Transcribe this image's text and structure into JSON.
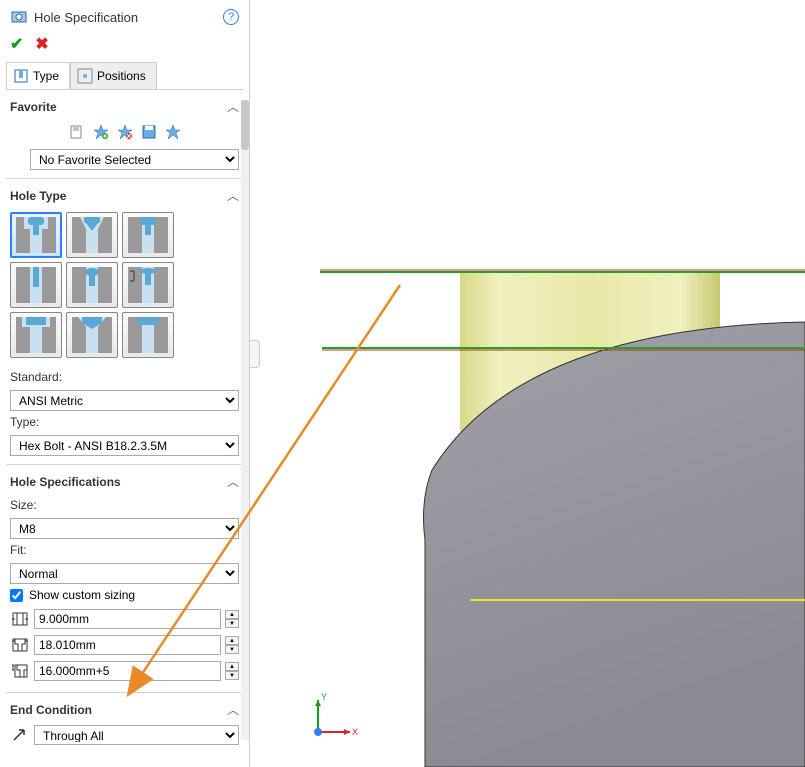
{
  "header": {
    "title": "Hole Specification"
  },
  "tabs": {
    "type": "Type",
    "positions": "Positions"
  },
  "sections": {
    "favorite": {
      "title": "Favorite"
    },
    "holeType": {
      "title": "Hole Type"
    },
    "holeSpecs": {
      "title": "Hole Specifications"
    },
    "endCondition": {
      "title": "End Condition"
    }
  },
  "favorites": {
    "selected": "No Favorite Selected"
  },
  "standard": {
    "label": "Standard:",
    "value": "ANSI Metric"
  },
  "type": {
    "label": "Type:",
    "value": "Hex Bolt - ANSI B18.2.3.5M"
  },
  "size": {
    "label": "Size:",
    "value": "M8"
  },
  "fit": {
    "label": "Fit:",
    "value": "Normal"
  },
  "showCustom": {
    "label": "Show custom sizing",
    "checked": true
  },
  "dims": {
    "d1": "9.000mm",
    "d2": "18.010mm",
    "d3": "16.000mm+5"
  },
  "endCondition": {
    "value": "Through All"
  },
  "triad": {
    "x": "X",
    "y": "Y"
  }
}
